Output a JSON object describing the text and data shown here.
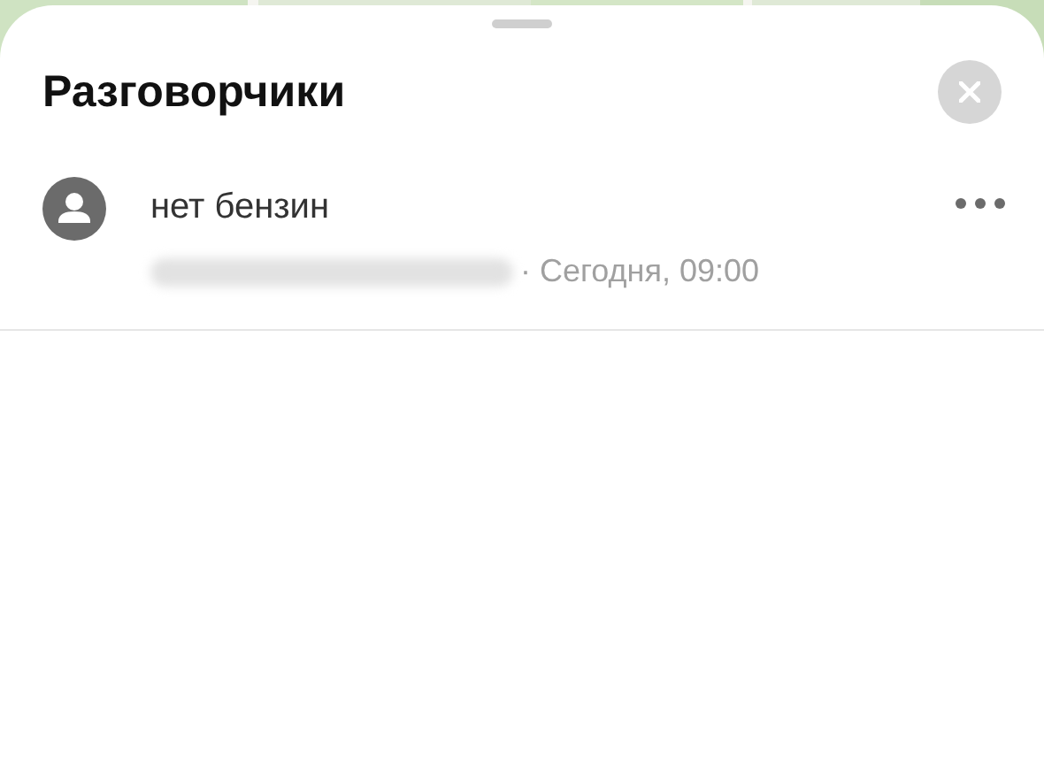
{
  "sheet": {
    "title": "Разговорчики"
  },
  "conversations": [
    {
      "title": "нет бензин",
      "author_hidden": true,
      "meta": "· Сегодня, 09:00"
    }
  ]
}
